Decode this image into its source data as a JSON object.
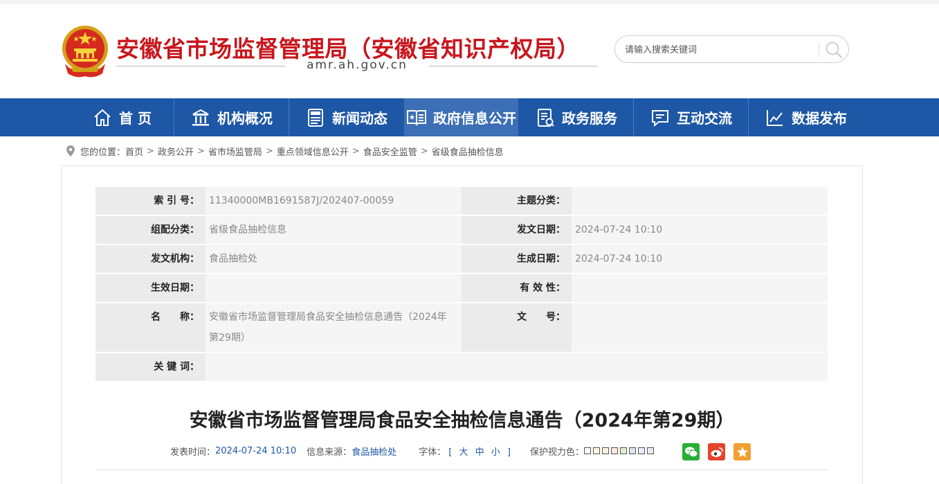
{
  "header": {
    "site_title": "安徽省市场监督管理局（安徽省知识产权局）",
    "domain": "amr.ah.gov.cn",
    "search_placeholder": "请输入搜索关键词"
  },
  "nav": {
    "items": [
      {
        "label": "首 页",
        "icon": "home-icon"
      },
      {
        "label": "机构概况",
        "icon": "building-icon"
      },
      {
        "label": "新闻动态",
        "icon": "news-icon"
      },
      {
        "label": "政府信息公开",
        "icon": "open-book-icon",
        "active": true
      },
      {
        "label": "政务服务",
        "icon": "service-doc-icon"
      },
      {
        "label": "互动交流",
        "icon": "chat-icon"
      },
      {
        "label": "数据发布",
        "icon": "chart-icon"
      }
    ]
  },
  "breadcrumb": {
    "prefix": "您的位置：",
    "items": [
      "首页",
      "政务公开",
      "省市场监管局",
      "重点领域信息公开",
      "食品安全监管",
      "省级食品抽检信息"
    ]
  },
  "meta": {
    "index_no_label": "索 引 号：",
    "index_no": "11340000MB1691587J/202407-00059",
    "topic_label": "主题分类：",
    "topic": "",
    "group_label": "组配分类：",
    "group": "省级食品抽检信息",
    "issue_date_label": "发文日期：",
    "issue_date": "2024-07-24 10:10",
    "issuer_label": "发文机构：",
    "issuer": "食品抽检处",
    "gen_date_label": "生成日期：",
    "gen_date": "2024-07-24 10:10",
    "effective_date_label": "生效日期：",
    "effective_date": "",
    "validity_label": "有 效 性：",
    "validity": "",
    "name_label": "名　　称：",
    "name": "安徽省市场监督管理局食品安全抽检信息通告（2024年第29期）",
    "doc_no_label": "文　　号：",
    "doc_no": "",
    "keywords_label": "关 键 词：",
    "keywords": ""
  },
  "article": {
    "title": "安徽省市场监督管理局食品安全抽检信息通告（2024年第29期）",
    "publish_label": "发表时间：",
    "publish_time": "2024-07-24 10:10",
    "source_label": "信息来源：",
    "source": "食品抽检处",
    "font_label": "字体：",
    "font_open": "[",
    "font_large": "大",
    "font_medium": "中",
    "font_small": "小",
    "font_close": "]",
    "color_label": "保护视力色："
  },
  "colors": {
    "brand_red": "#c8161d",
    "nav_blue": "#1d57a5",
    "nav_active": "#3c6fb5",
    "wechat": "#2aae38",
    "weibo": "#e6452d",
    "favorite": "#f0a030",
    "swatches": [
      "#ffffff",
      "#faf9de",
      "#fff2e2",
      "#fde6e0",
      "#e3edcd",
      "#dce2f1",
      "#e9ebfe",
      "#eaeaef"
    ]
  }
}
